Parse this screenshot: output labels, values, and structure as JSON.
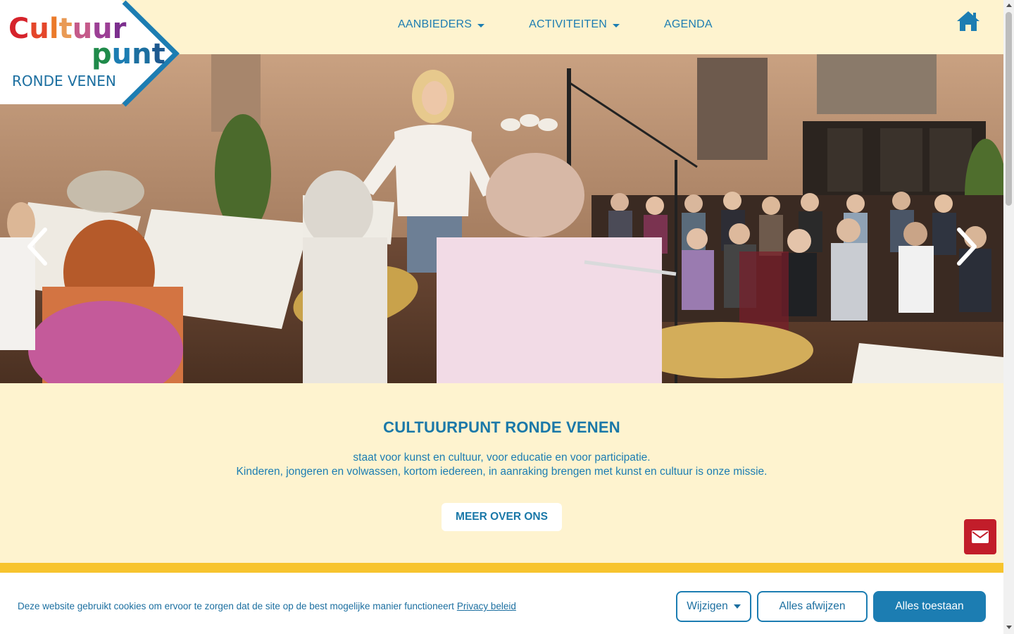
{
  "logo": {
    "line1": "Cultuur",
    "line2": "punt",
    "line3": "RONDE VENEN"
  },
  "nav": {
    "items": [
      {
        "label": "AANBIEDERS",
        "has_dropdown": true
      },
      {
        "label": "ACTIVITEITEN",
        "has_dropdown": true
      },
      {
        "label": "AGENDA",
        "has_dropdown": false
      }
    ],
    "home_icon": "home-icon"
  },
  "hero": {
    "prev_icon": "chevron-left-icon",
    "next_icon": "chevron-right-icon"
  },
  "intro": {
    "title": "CULTUURPUNT RONDE VENEN",
    "line1": "staat voor kunst en cultuur, voor educatie en voor participatie.",
    "line2": "Kinderen, jongeren en volwassen, kortom iedereen, in aanraking brengen met kunst en cultuur is onze missie.",
    "button": "MEER OVER ONS"
  },
  "mail_button": {
    "icon": "envelope-icon"
  },
  "cookie": {
    "text": "Deze website gebruikt cookies om ervoor te zorgen dat de site op de best mogelijke manier functioneert",
    "privacy_link": "Privacy beleid",
    "change_label": "Wijzigen",
    "reject_label": "Alles afwijzen",
    "accept_label": "Alles toestaan"
  },
  "colors": {
    "background": "#fef3cf",
    "accent_blue": "#1c7db2",
    "band_yellow": "#f7c42e",
    "mail_red": "#c21d2a"
  }
}
